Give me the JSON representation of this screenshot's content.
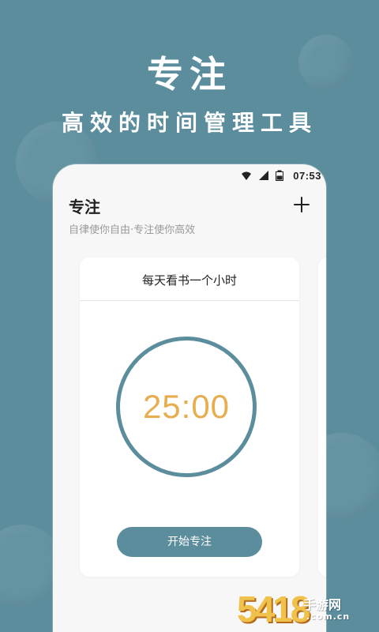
{
  "hero": {
    "title": "专注",
    "subtitle": "高效的时间管理工具"
  },
  "status_bar": {
    "time": "07:53",
    "icons": [
      "wifi-icon",
      "signal-icon",
      "battery-icon"
    ]
  },
  "app": {
    "title": "专注",
    "subtitle": "自律使你自由·专注使你高效",
    "add_icon": "plus-icon"
  },
  "card": {
    "title": "每天看书一个小时",
    "timer": "25:00",
    "start_label": "开始专注"
  },
  "watermark": {
    "number": "5418",
    "text": "手游网",
    "domain": ".com.cn"
  },
  "colors": {
    "background": "#5b8d9d",
    "accent": "#5b8d9d",
    "timer": "#e7ad4f",
    "card": "#ffffff"
  }
}
